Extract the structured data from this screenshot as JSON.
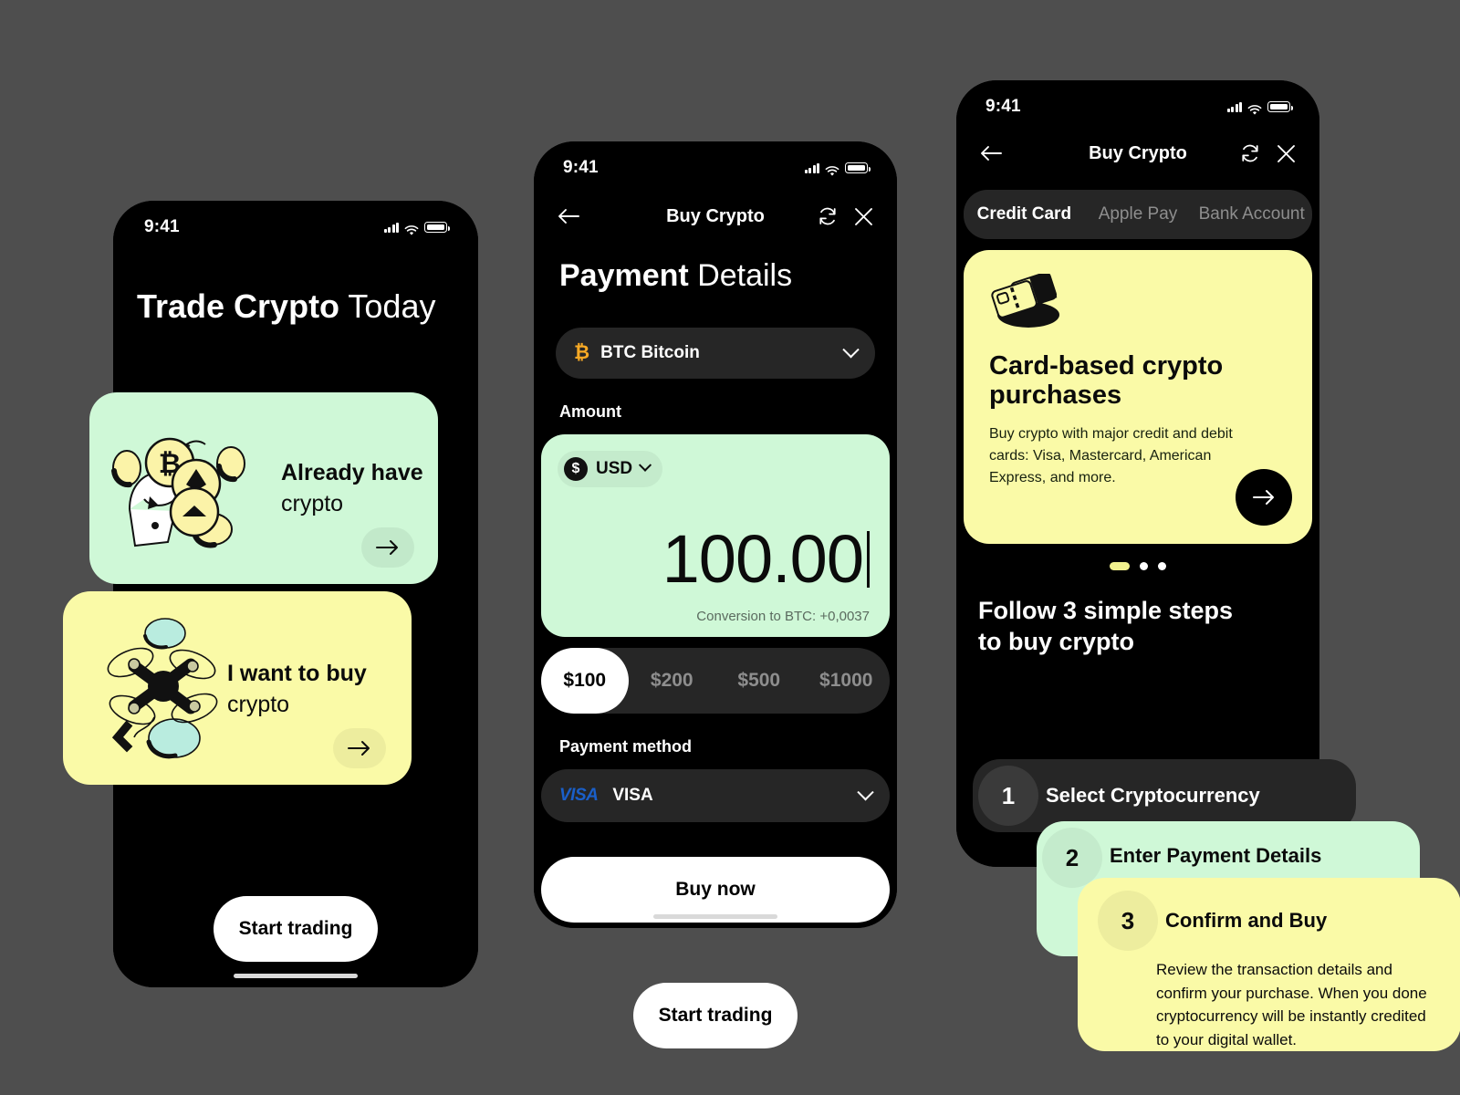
{
  "status_bar": {
    "time": "9:41"
  },
  "phone1": {
    "title_bold": "Trade Crypto",
    "title_light": "Today",
    "cards": [
      {
        "title": "Already have",
        "subtitle": "crypto",
        "color": "#cff8d7",
        "arrow": "arrow-right-icon"
      },
      {
        "title": "I want to buy",
        "subtitle": "crypto",
        "color": "#fafaa7",
        "arrow": "arrow-right-icon"
      }
    ],
    "cta": "Start trading"
  },
  "phone2": {
    "nav": {
      "title": "Buy Crypto",
      "back": "arrow-left-icon",
      "refresh": "refresh-icon",
      "close": "close-icon"
    },
    "heading_bold": "Payment",
    "heading_light": "Details",
    "coin_select": {
      "symbol": "₿",
      "label": "BTC Bitcoin"
    },
    "amount_label": "Amount",
    "currency": {
      "symbol": "$",
      "code": "USD"
    },
    "amount_value": "100.00",
    "conversion": "Conversion to BTC: +0,0037",
    "chips": [
      "$100",
      "$200",
      "$500",
      "$1000"
    ],
    "chip_active": "$100",
    "payment_method_label": "Payment method",
    "payment_method": {
      "brand": "VISA",
      "label": "VISA"
    },
    "buy_now": "Buy now",
    "floating_cta": "Start trading"
  },
  "phone3": {
    "nav": {
      "title": "Buy Crypto",
      "back": "arrow-left-icon",
      "refresh": "refresh-icon",
      "close": "close-icon"
    },
    "tabs": [
      "Credit Card",
      "Apple Pay",
      "Bank Account"
    ],
    "tab_active": "Credit Card",
    "promo": {
      "icon": "credit-cards-icon",
      "title": "Card-based crypto purchases",
      "body": "Buy crypto with major credit and debit cards: Visa, Mastercard, American Express, and more.",
      "arrow": "arrow-right-icon"
    },
    "carousel": {
      "total": 3,
      "active_index": 0
    },
    "steps_heading_line1": "Follow 3 simple steps",
    "steps_heading_line2": "to buy crypto",
    "steps": [
      {
        "num": "1",
        "title": "Select Cryptocurrency",
        "body": "",
        "color": "#262626"
      },
      {
        "num": "2",
        "title": "Enter Payment Details",
        "body": "",
        "color": "#cff8d7"
      },
      {
        "num": "3",
        "title": "Confirm and Buy",
        "body": "Review the transaction details and confirm your purchase. When you done cryptocurrency will be instantly credited to your digital wallet.",
        "color": "#fafaa7"
      }
    ]
  },
  "theme": {
    "background": "#4e4e4e",
    "surface_dark": "#000000",
    "surface_elevated": "#262626",
    "mint": "#cff8d7",
    "lemon": "#fafaa7",
    "bitcoin_orange": "#f7a925",
    "visa_blue": "#1a5fc8"
  }
}
